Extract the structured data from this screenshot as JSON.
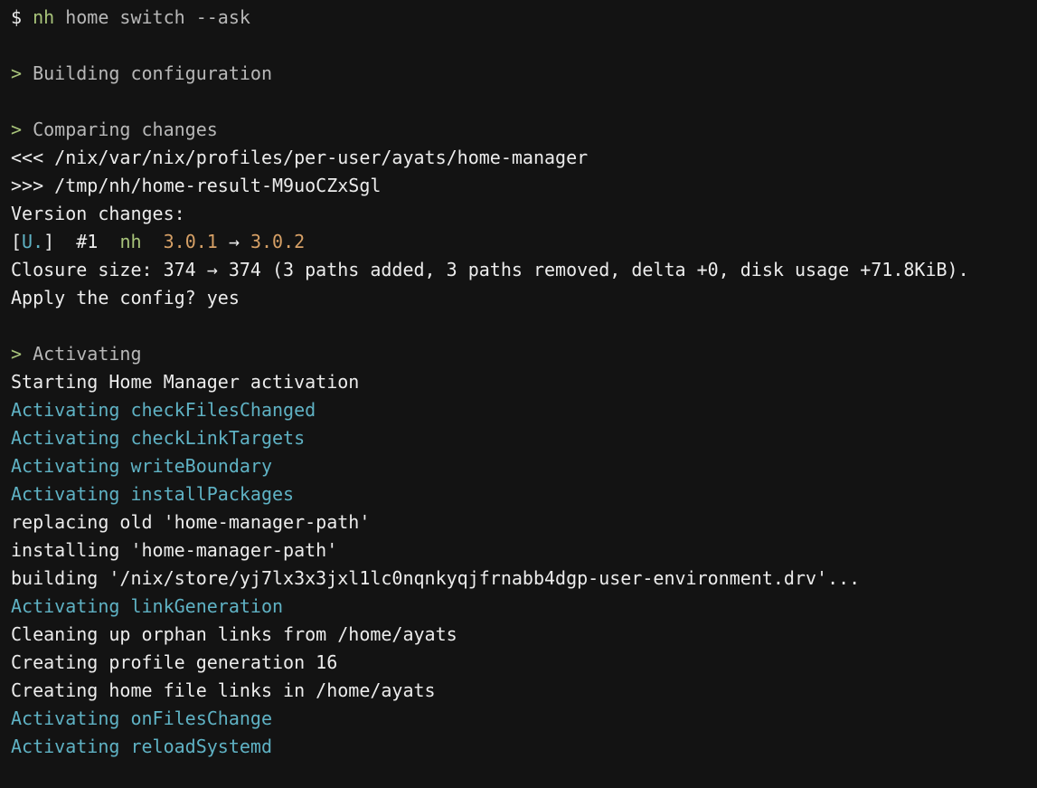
{
  "lines": [
    {
      "segments": [
        {
          "text": "$ ",
          "color": "#ececec"
        },
        {
          "text": "nh",
          "color": "#a8c47a"
        },
        {
          "text": " home switch --ask",
          "color": "#b8b8b8"
        }
      ]
    },
    {
      "segments": []
    },
    {
      "segments": [
        {
          "text": ">",
          "color": "#a8c47a"
        },
        {
          "text": " Building configuration",
          "color": "#b8b8b8"
        }
      ]
    },
    {
      "segments": []
    },
    {
      "segments": [
        {
          "text": ">",
          "color": "#a8c47a"
        },
        {
          "text": " Comparing changes",
          "color": "#b8b8b8"
        }
      ]
    },
    {
      "segments": [
        {
          "text": "<<< /nix/var/nix/profiles/per-user/ayats/home-manager",
          "color": "#ececec"
        }
      ]
    },
    {
      "segments": [
        {
          "text": ">>> /tmp/nh/home-result-M9uoCZxSgl",
          "color": "#ececec"
        }
      ]
    },
    {
      "segments": [
        {
          "text": "Version changes:",
          "color": "#ececec"
        }
      ]
    },
    {
      "segments": [
        {
          "text": "[",
          "color": "#ececec"
        },
        {
          "text": "U.",
          "color": "#5fb2c4"
        },
        {
          "text": "]  #1  ",
          "color": "#ececec"
        },
        {
          "text": "nh",
          "color": "#a8c47a"
        },
        {
          "text": "  ",
          "color": "#ececec"
        },
        {
          "text": "3.0.1",
          "color": "#d6a066"
        },
        {
          "text": " → ",
          "color": "#ececec"
        },
        {
          "text": "3.0.2",
          "color": "#d6a066"
        }
      ]
    },
    {
      "segments": [
        {
          "text": "Closure size: 374 → 374 (3 paths added, 3 paths removed, delta +0, disk usage +71.8KiB).",
          "color": "#ececec"
        }
      ]
    },
    {
      "segments": [
        {
          "text": "Apply the config? yes",
          "color": "#ececec"
        }
      ]
    },
    {
      "segments": []
    },
    {
      "segments": [
        {
          "text": ">",
          "color": "#a8c47a"
        },
        {
          "text": " Activating",
          "color": "#b8b8b8"
        }
      ]
    },
    {
      "segments": [
        {
          "text": "Starting Home Manager activation",
          "color": "#ececec"
        }
      ]
    },
    {
      "segments": [
        {
          "text": "Activating checkFilesChanged",
          "color": "#5fb2c4"
        }
      ]
    },
    {
      "segments": [
        {
          "text": "Activating checkLinkTargets",
          "color": "#5fb2c4"
        }
      ]
    },
    {
      "segments": [
        {
          "text": "Activating writeBoundary",
          "color": "#5fb2c4"
        }
      ]
    },
    {
      "segments": [
        {
          "text": "Activating installPackages",
          "color": "#5fb2c4"
        }
      ]
    },
    {
      "segments": [
        {
          "text": "replacing old 'home-manager-path'",
          "color": "#ececec"
        }
      ]
    },
    {
      "segments": [
        {
          "text": "installing 'home-manager-path'",
          "color": "#ececec"
        }
      ]
    },
    {
      "segments": [
        {
          "text": "building '/nix/store/yj7lx3x3jxl1lc0nqnkyqjfrnabb4dgp-user-environment.drv'...",
          "color": "#ececec"
        }
      ]
    },
    {
      "segments": [
        {
          "text": "Activating linkGeneration",
          "color": "#5fb2c4"
        }
      ]
    },
    {
      "segments": [
        {
          "text": "Cleaning up orphan links from /home/ayats",
          "color": "#ececec"
        }
      ]
    },
    {
      "segments": [
        {
          "text": "Creating profile generation 16",
          "color": "#ececec"
        }
      ]
    },
    {
      "segments": [
        {
          "text": "Creating home file links in /home/ayats",
          "color": "#ececec"
        }
      ]
    },
    {
      "segments": [
        {
          "text": "Activating onFilesChange",
          "color": "#5fb2c4"
        }
      ]
    },
    {
      "segments": [
        {
          "text": "Activating reloadSystemd",
          "color": "#5fb2c4"
        }
      ]
    }
  ]
}
